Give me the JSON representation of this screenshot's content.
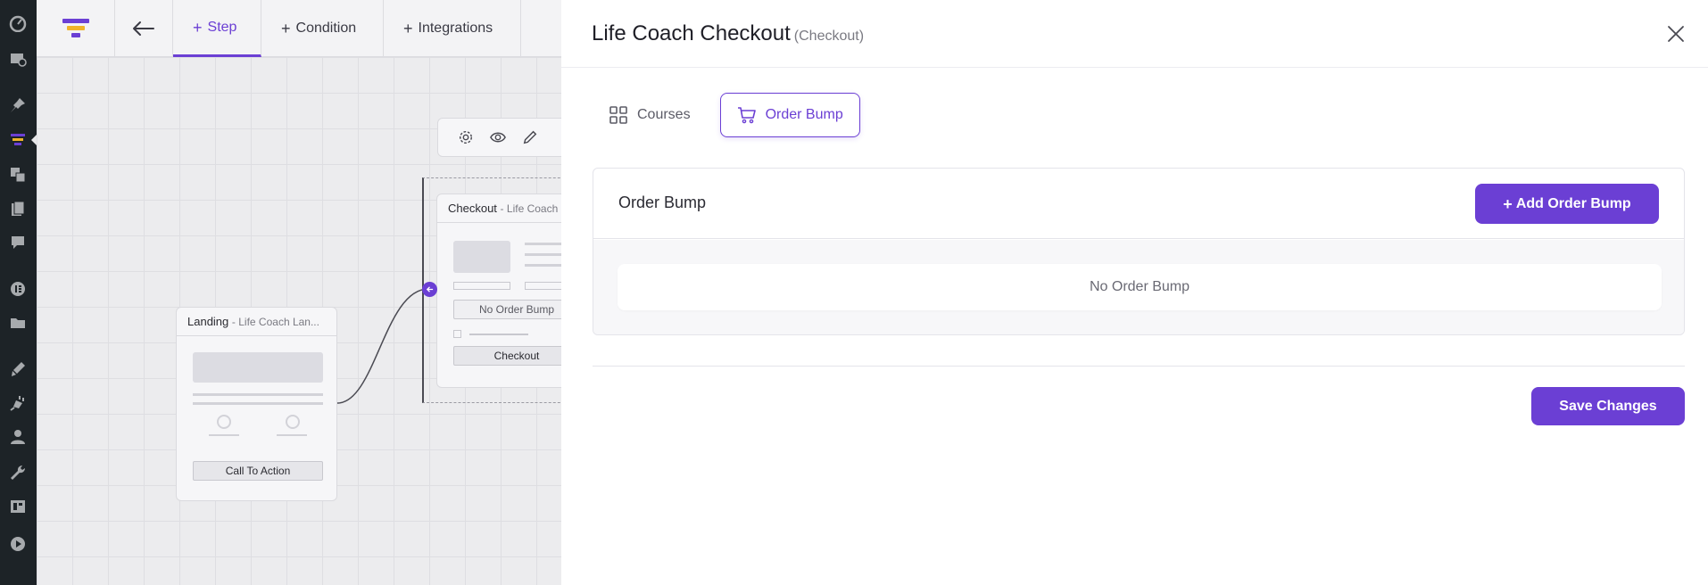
{
  "colors": {
    "accent": "#6b3fd4",
    "wp_sidebar": "#1d2327",
    "canvas_bg": "#ececee"
  },
  "wp_sidebar": {
    "icons": [
      "dashboard-icon",
      "media-library-icon",
      "pin-icon",
      "funnel-icon",
      "media-icon",
      "pages-icon",
      "comments-icon",
      "elementor-icon",
      "folders-icon",
      "appearance-icon",
      "plugins-icon",
      "users-icon",
      "tools-icon",
      "templates-icon",
      "play-icon"
    ]
  },
  "topbar": {
    "tabs": [
      {
        "label": "Step",
        "active": true
      },
      {
        "label": "Condition",
        "active": false
      },
      {
        "label": "Integrations",
        "active": false
      }
    ]
  },
  "canvas": {
    "landing_node": {
      "title": "Landing",
      "subtitle": "Life Coach Lan...",
      "button": "Call To Action"
    },
    "checkout_node": {
      "title": "Checkout",
      "subtitle": "Life Coach",
      "order_bump": "No Order Bump",
      "button": "Checkout"
    }
  },
  "panel": {
    "title": "Life Coach Checkout",
    "type": "(Checkout)",
    "tabs": [
      {
        "label": "Courses",
        "icon": "grid-icon",
        "active": false
      },
      {
        "label": "Order Bump",
        "icon": "cart-icon",
        "active": true
      }
    ],
    "card": {
      "title": "Order Bump",
      "add_button": "Add Order Bump",
      "empty_text": "No Order Bump"
    },
    "save_button": "Save Changes"
  }
}
